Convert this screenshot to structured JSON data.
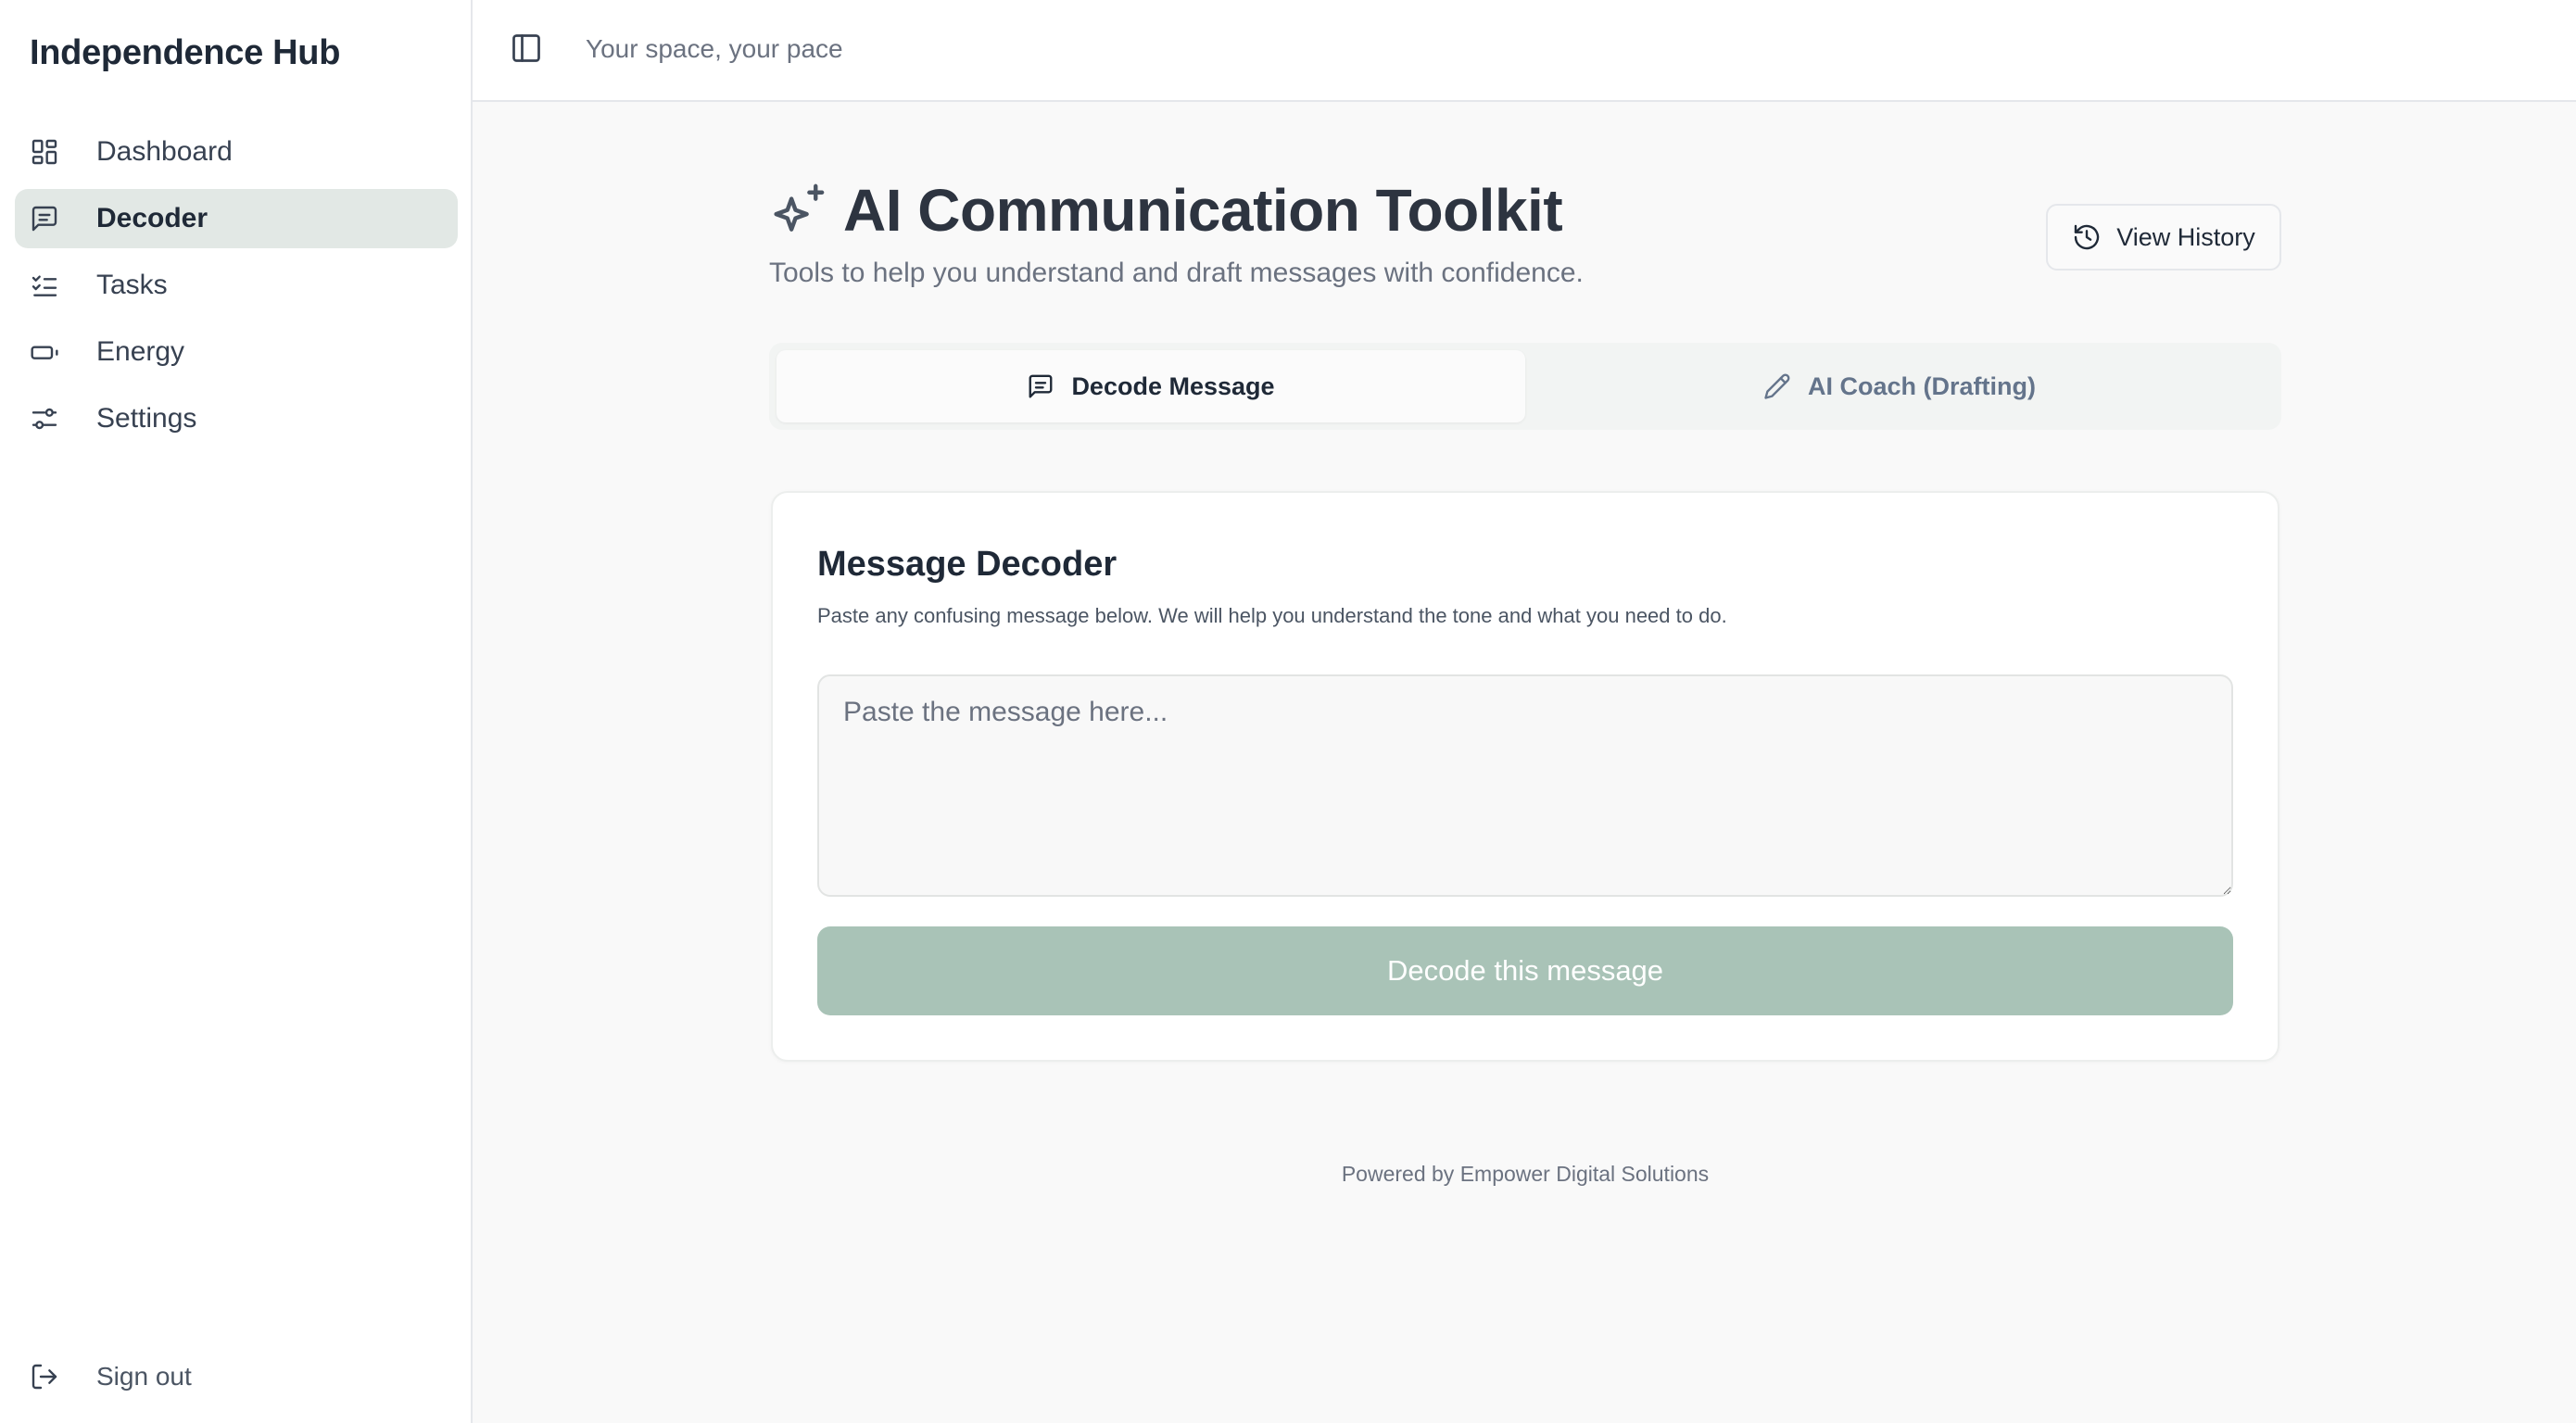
{
  "sidebar": {
    "brand": "Independence Hub",
    "items": [
      {
        "label": "Dashboard",
        "icon": "dashboard-icon",
        "active": false
      },
      {
        "label": "Decoder",
        "icon": "message-square-icon",
        "active": true
      },
      {
        "label": "Tasks",
        "icon": "list-checks-icon",
        "active": false
      },
      {
        "label": "Energy",
        "icon": "battery-icon",
        "active": false
      },
      {
        "label": "Settings",
        "icon": "sliders-icon",
        "active": false
      }
    ],
    "sign_out": {
      "label": "Sign out",
      "icon": "log-out-icon"
    }
  },
  "topbar": {
    "toggle_icon": "sidebar-toggle-icon",
    "tagline": "Your space, your pace"
  },
  "page": {
    "icon": "sparkles-icon",
    "title": "AI Communication Toolkit",
    "subtitle": "Tools to help you understand and draft messages with confidence.",
    "history_button": {
      "label": "View History",
      "icon": "history-icon"
    }
  },
  "tabs": [
    {
      "label": "Decode Message",
      "icon": "message-square-icon",
      "active": true
    },
    {
      "label": "AI Coach (Drafting)",
      "icon": "pencil-icon",
      "active": false
    }
  ],
  "decoder_card": {
    "title": "Message Decoder",
    "description": "Paste any confusing message below. We will help you understand the tone and what you need to do.",
    "input_value": "",
    "input_placeholder": "Paste the message here...",
    "submit_label": "Decode this message"
  },
  "footer": {
    "text": "Powered by Empower Digital Solutions"
  },
  "colors": {
    "sidebar_active_bg": "#e2e8e5",
    "primary_button": "#a9c3b7",
    "page_bg": "#f9f9f9",
    "text_primary": "#1f2937",
    "text_muted": "#6b7280"
  }
}
